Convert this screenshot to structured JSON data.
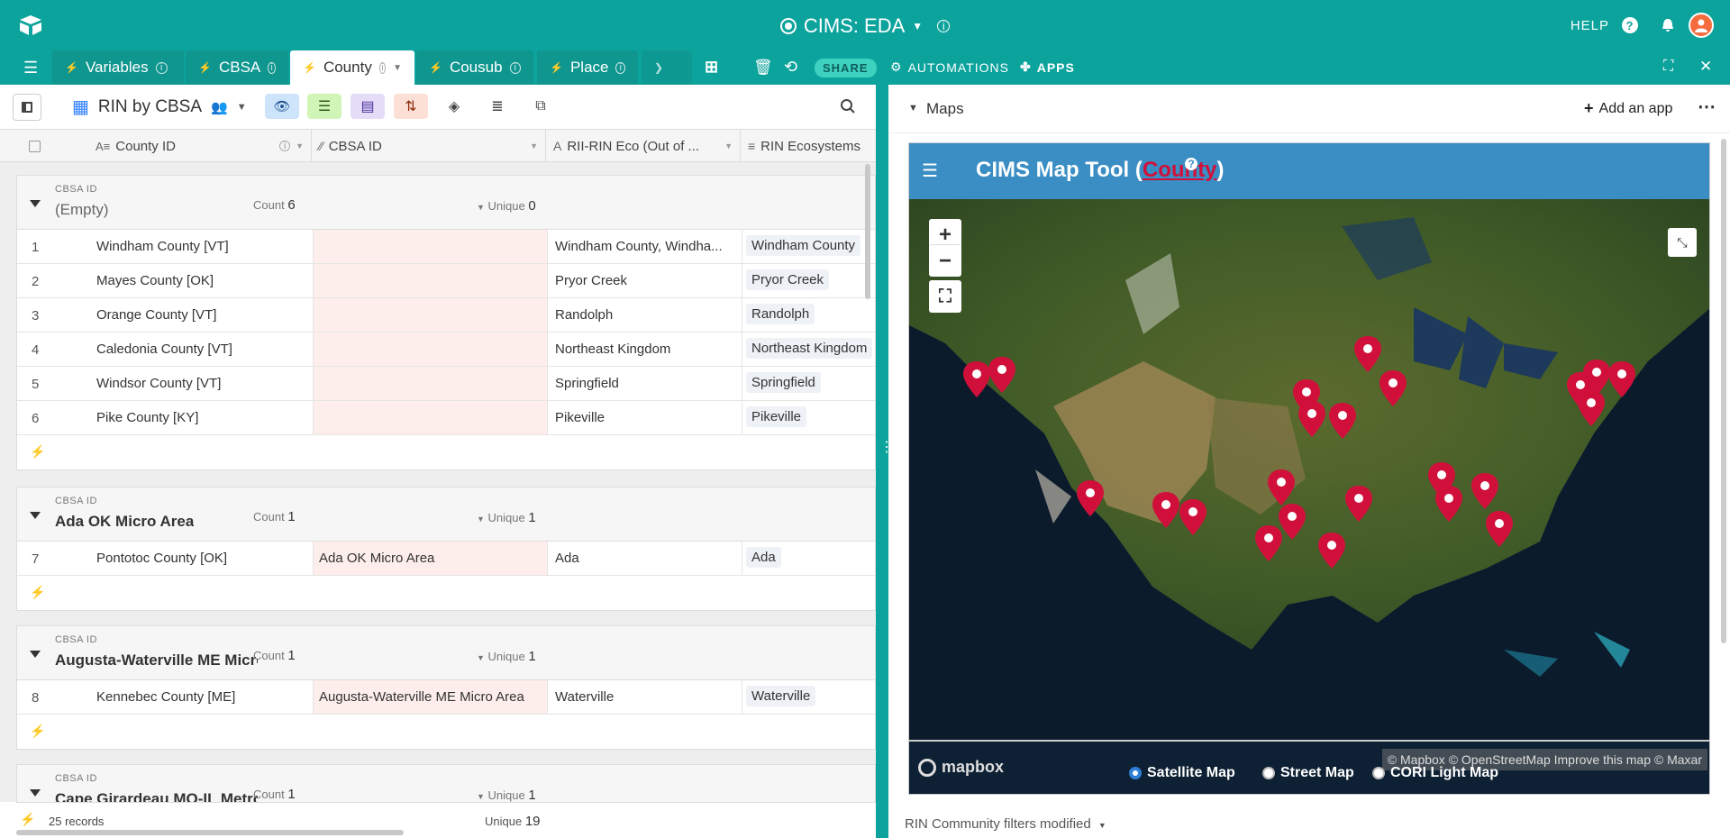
{
  "app": {
    "base_title": "CIMS: EDA",
    "help_label": "HELP"
  },
  "tabs": [
    {
      "label": "Variables"
    },
    {
      "label": "CBSA"
    },
    {
      "label": "County"
    },
    {
      "label": "Cousub"
    },
    {
      "label": "Place"
    }
  ],
  "toolbar": {
    "share_label": "SHARE",
    "automations_label": "AUTOMATIONS",
    "apps_label": "APPS"
  },
  "view": {
    "name": "RIN by CBSA"
  },
  "columns": [
    {
      "label": "County ID"
    },
    {
      "label": "CBSA ID"
    },
    {
      "label": "RII-RIN Eco (Out of ..."
    },
    {
      "label": "RIN Ecosystems"
    }
  ],
  "groups": [
    {
      "key": "CBSA ID",
      "value": "(Empty)",
      "count_label": "Count",
      "count": "6",
      "unique_label": "Unique",
      "unique": "0",
      "rows": [
        {
          "num": "1",
          "county": "Windham County [VT]",
          "cbsa": "",
          "eco": "Windham County, Windha...",
          "ecosystem": "Windham County"
        },
        {
          "num": "2",
          "county": "Mayes County [OK]",
          "cbsa": "",
          "eco": "Pryor Creek",
          "ecosystem": "Pryor Creek"
        },
        {
          "num": "3",
          "county": "Orange County [VT]",
          "cbsa": "",
          "eco": "Randolph",
          "ecosystem": "Randolph"
        },
        {
          "num": "4",
          "county": "Caledonia County [VT]",
          "cbsa": "",
          "eco": "Northeast Kingdom",
          "ecosystem": "Northeast Kingdom"
        },
        {
          "num": "5",
          "county": "Windsor County [VT]",
          "cbsa": "",
          "eco": "Springfield",
          "ecosystem": "Springfield"
        },
        {
          "num": "6",
          "county": "Pike County [KY]",
          "cbsa": "",
          "eco": "Pikeville",
          "ecosystem": "Pikeville"
        }
      ]
    },
    {
      "key": "CBSA ID",
      "value": "Ada OK Micro Area",
      "count_label": "Count",
      "count": "1",
      "unique_label": "Unique",
      "unique": "1",
      "rows": [
        {
          "num": "7",
          "county": "Pontotoc County [OK]",
          "cbsa": "Ada OK Micro Area",
          "eco": "Ada",
          "ecosystem": "Ada"
        }
      ]
    },
    {
      "key": "CBSA ID",
      "value": "Augusta-Waterville ME Micro Area",
      "count_label": "Count",
      "count": "1",
      "unique_label": "Unique",
      "unique": "1",
      "rows": [
        {
          "num": "8",
          "county": "Kennebec County [ME]",
          "cbsa": "Augusta-Waterville ME Micro Area",
          "eco": "Waterville",
          "ecosystem": "Waterville"
        }
      ]
    },
    {
      "key": "CBSA ID",
      "value": "Cape Girardeau MO-IL Metro Area",
      "count_label": "Count",
      "count": "1",
      "unique_label": "Unique",
      "unique": "1",
      "rows": []
    }
  ],
  "footer": {
    "records": "25 records",
    "unique_label": "Unique",
    "unique": "19"
  },
  "right_panel": {
    "title": "Maps",
    "add_app_label": "Add an app",
    "map_title_prefix": "CIMS Map Tool (",
    "map_title_highlight": "County",
    "map_title_suffix": ")",
    "map_options": [
      "Satellite Map",
      "Street Map",
      "CORI Light Map"
    ],
    "selected_map": "Satellite Map",
    "attribution": "© Mapbox © OpenStreetMap Improve this map © Maxar",
    "mapbox_label": "mapbox",
    "filters_text": "RIN Community filters modified"
  },
  "colors": {
    "brand": "#0ba39c",
    "pin": "#d0103a",
    "map_header": "#3a8ec4"
  }
}
